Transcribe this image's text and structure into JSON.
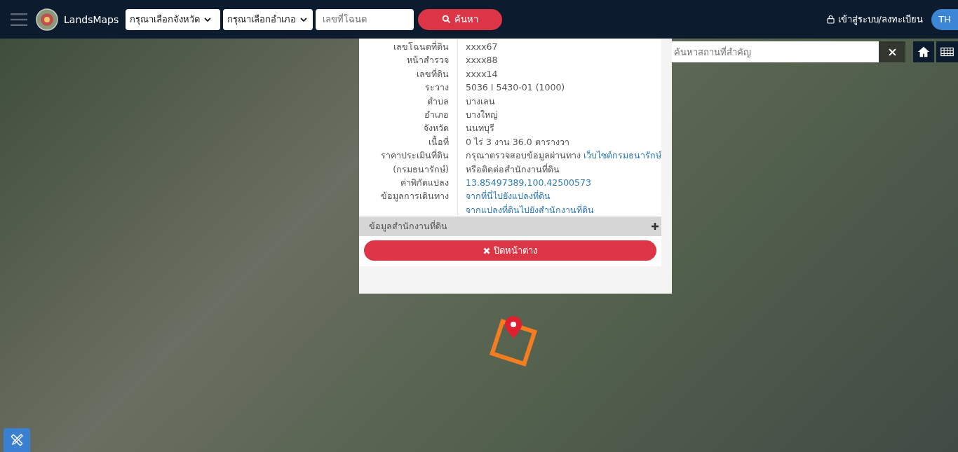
{
  "header": {
    "brand": "LandsMaps",
    "province_select": {
      "value": "กรุณาเลือกจังหวัด"
    },
    "district_select": {
      "value": "กรุณาเลือกอำเภอ"
    },
    "deed_field": {
      "placeholder": "เลขที่โฉนด"
    },
    "search_button": "ค้นหา",
    "login_link": "เข้าสู่ระบบ/ลงทะเบียน",
    "language_button": "TH"
  },
  "map": {
    "place_search": {
      "placeholder": "ค้นหาสถานที่สำคัญ"
    }
  },
  "parcel_popup": {
    "rows": [
      {
        "label": "เลขโฉนดที่ดิน",
        "value": "xxxx67"
      },
      {
        "label": "หน้าสำรวจ",
        "value": "xxxx88"
      },
      {
        "label": "เลขที่ดิน",
        "value": "xxxx14"
      },
      {
        "label": "ระวาง",
        "value": "5036 I 5430-01 (1000)"
      },
      {
        "label": "ตำบล",
        "value": "บางเลน"
      },
      {
        "label": "อำเภอ",
        "value": "บางใหญ่"
      },
      {
        "label": "จังหวัด",
        "value": "นนทบุรี"
      },
      {
        "label": "เนื้อที่",
        "value": "0 ไร่ 3 งาน 36.0 ตารางวา"
      },
      {
        "label": "ราคาประเมินที่ดิน",
        "value": "กรุณาตรวจสอบข้อมูลผ่านทาง",
        "link": "เว็บไซต์กรมธนารักษ์"
      },
      {
        "label": "(กรมธนารักษ์)",
        "value": "หรือติดต่อสำนักงานที่ดิน"
      },
      {
        "label": "ค่าพิกัดแปลง",
        "link": "13.85497389,100.42500573"
      },
      {
        "label": "ข้อมูลการเดินทาง",
        "link": "จากที่นี่ไปยังแปลงที่ดิน"
      },
      {
        "link": "จากแปลงที่ดินไปยังสำนักงานที่ดิน"
      }
    ],
    "office_section": {
      "title": "ข้อมูลสำนักงานที่ดิน",
      "expanded": false
    },
    "close_button": "ปิดหน้าต่าง"
  }
}
